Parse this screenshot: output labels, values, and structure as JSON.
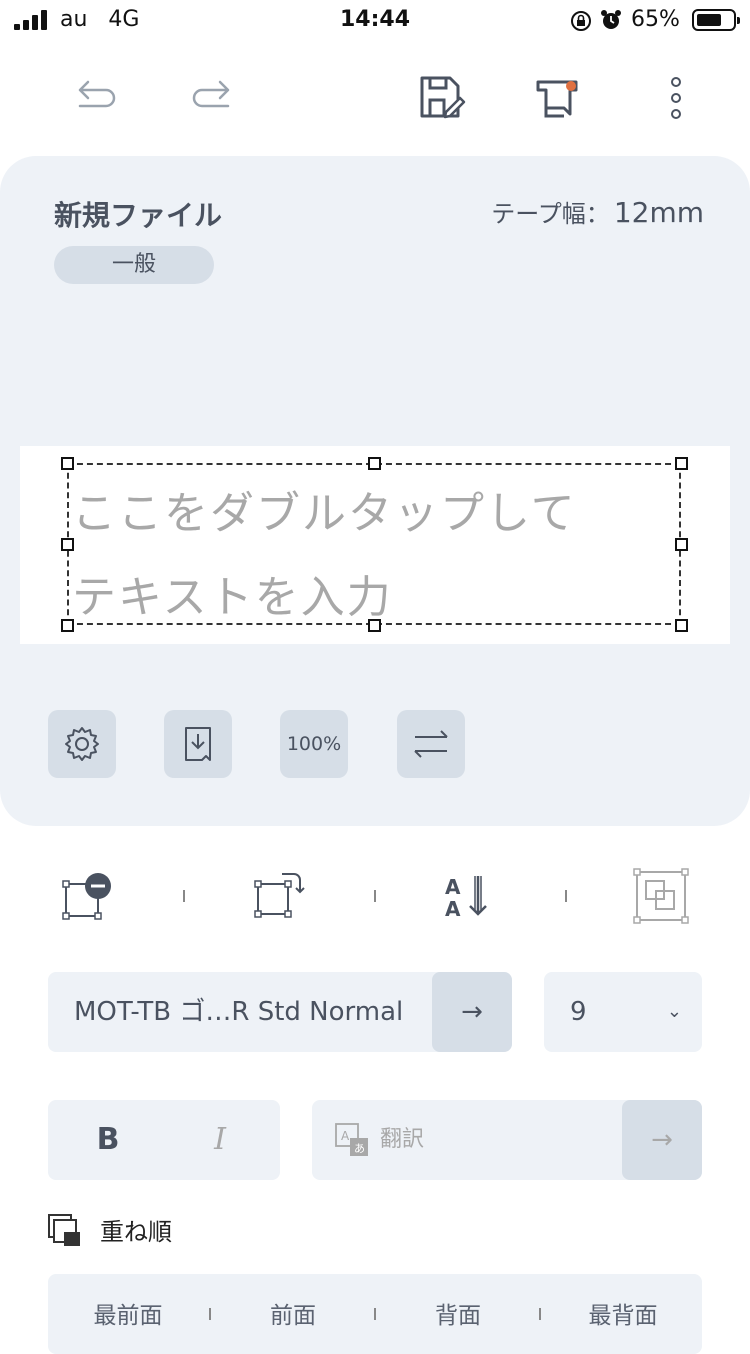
{
  "status_bar": {
    "carrier": "au",
    "network": "4G",
    "time": "14:44",
    "battery": "65%"
  },
  "toolbar": {
    "icons": [
      "undo-icon",
      "redo-icon",
      "save-icon",
      "print-icon",
      "more-icon"
    ]
  },
  "card": {
    "file_title": "新規ファイル",
    "tape_width_label": "テープ幅：",
    "tape_width_value": "12mm",
    "category_tag": "一般",
    "placeholder_line1": "ここをダブルタップして",
    "placeholder_line2": "テキストを入力",
    "zoom": "100%",
    "buttons": [
      "settings-icon",
      "import-icon",
      "zoom-button",
      "swap-icon"
    ]
  },
  "tools": {
    "icons": [
      "remove-object-icon",
      "rotate-object-icon",
      "vertical-text-icon",
      "overlap-icon"
    ]
  },
  "font": {
    "name": "MOT-TB ゴ…R Std Normal",
    "arrow": "→",
    "size": "9",
    "size_chevron": "⌄"
  },
  "style": {
    "bold": "B",
    "italic": "I",
    "translate_label": "翻訳",
    "translate_arrow": "→"
  },
  "order": {
    "title": "重ね順",
    "items": [
      "最前面",
      "前面",
      "背面",
      "最背面"
    ]
  },
  "colors": {
    "card_bg": "#eef2f7",
    "button_bg": "#d6dee7",
    "text": "#4a5260",
    "accent_dot": "#e07040"
  }
}
